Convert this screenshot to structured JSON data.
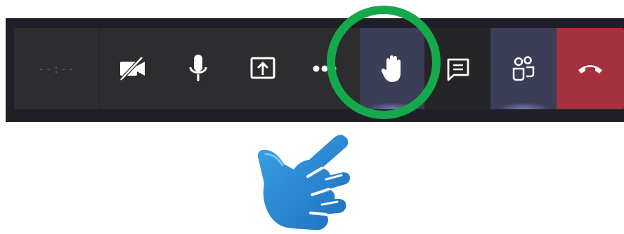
{
  "toolbar": {
    "timer": {
      "text": "--:--",
      "label": "call-duration"
    },
    "buttons": [
      {
        "id": "camera",
        "icon": "camera-off-icon",
        "state": "off"
      },
      {
        "id": "mic",
        "icon": "microphone-icon",
        "state": "on"
      },
      {
        "id": "share",
        "icon": "share-screen-icon"
      },
      {
        "id": "more",
        "icon": "more-options-icon"
      },
      {
        "id": "raise-hand",
        "icon": "raise-hand-icon",
        "state": "active"
      },
      {
        "id": "chat",
        "icon": "chat-icon"
      },
      {
        "id": "participants",
        "icon": "participants-icon",
        "state": "active"
      },
      {
        "id": "leave",
        "icon": "hang-up-icon"
      }
    ]
  },
  "annotation": {
    "highlight": "highlight-circle",
    "pointer": "pointing-hand"
  },
  "colors": {
    "toolbar_bg": "#2d2d30",
    "frame_bg": "#1f1f28",
    "active_bg": "#3c3d57",
    "leave_bg": "#a4313d",
    "highlight_ring": "#14a94b",
    "pointer_hand": "#2f8fd8",
    "icon": "#ffffff"
  }
}
